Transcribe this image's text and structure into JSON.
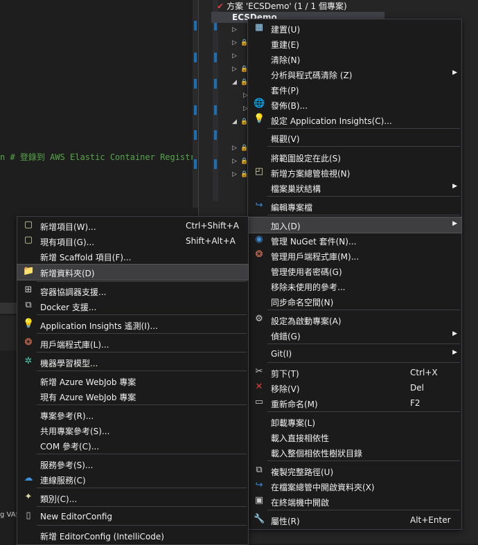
{
  "editor": {
    "code_text": "n # 登錄到 AWS Elastic Container Registry",
    "vas_text": "g VAS"
  },
  "solution_explorer": {
    "solution_label": "方案 'ECSDemo' (1 / 1 個專案)",
    "project_label": "ECSDemo"
  },
  "main_menu": {
    "items": [
      {
        "icon": "build-icon",
        "label": "建置(U)"
      },
      {
        "icon": "",
        "label": "重建(E)"
      },
      {
        "icon": "",
        "label": "清除(N)"
      },
      {
        "icon": "",
        "label": "分析與程式碼清除 (Z)",
        "arrow": "▶"
      },
      {
        "icon": "",
        "label": "套件(P)"
      },
      {
        "icon": "publish-icon",
        "label": "發佈(B)..."
      },
      {
        "icon": "app-insights-icon",
        "label": "設定 Application Insights(C)..."
      },
      {
        "icon": "",
        "label": "概觀(V)"
      },
      {
        "icon": "",
        "label": "將範圍設定在此(S)"
      },
      {
        "icon": "new-view-icon",
        "label": "新增方案總管檢視(N)"
      },
      {
        "icon": "",
        "label": "檔案巢狀結構",
        "arrow": "▶"
      },
      {
        "icon": "edit-project-icon",
        "label": "編輯專案檔"
      },
      {
        "icon": "",
        "label": "加入(D)",
        "arrow": "▶"
      },
      {
        "icon": "nuget-icon",
        "label": "管理 NuGet 套件(N)..."
      },
      {
        "icon": "client-lib-icon",
        "label": "管理用戶端程式庫(M)..."
      },
      {
        "icon": "",
        "label": "管理使用者密碼(G)"
      },
      {
        "icon": "",
        "label": "移除未使用的參考..."
      },
      {
        "icon": "",
        "label": "同步命名空間(N)"
      },
      {
        "icon": "gear-icon",
        "label": "設定為啟動專案(A)"
      },
      {
        "icon": "",
        "label": "偵錯(G)",
        "arrow": "▶"
      },
      {
        "icon": "",
        "label": "Git(I)",
        "arrow": "▶"
      },
      {
        "icon": "scissors-icon",
        "label": "剪下(T)",
        "shortcut": "Ctrl+X"
      },
      {
        "icon": "delete-icon",
        "label": "移除(V)",
        "shortcut": "Del"
      },
      {
        "icon": "rename-icon",
        "label": "重新命名(M)",
        "shortcut": "F2"
      },
      {
        "icon": "",
        "label": "卸載專案(L)"
      },
      {
        "icon": "",
        "label": "載入直接相依性"
      },
      {
        "icon": "",
        "label": "載入整個相依性樹狀目錄"
      },
      {
        "icon": "copy-icon",
        "label": "複製完整路徑(U)"
      },
      {
        "icon": "open-folder-icon",
        "label": "在檔案總管中開啟資料夾(X)"
      },
      {
        "icon": "terminal-icon",
        "label": "在終端機中開啟"
      },
      {
        "icon": "wrench-icon",
        "label": "屬性(R)",
        "shortcut": "Alt+Enter"
      }
    ]
  },
  "sub_menu": {
    "items": [
      {
        "icon": "new-item-icon",
        "label": "新增項目(W)...",
        "shortcut": "Ctrl+Shift+A"
      },
      {
        "icon": "existing-item-icon",
        "label": "現有項目(G)...",
        "shortcut": "Shift+Alt+A"
      },
      {
        "icon": "",
        "label": "新增 Scaffold 項目(F)..."
      },
      {
        "icon": "new-folder-icon",
        "label": "新增資料夾(D)"
      },
      {
        "icon": "container-orchestrator-icon",
        "label": "容器協調器支援..."
      },
      {
        "icon": "docker-icon",
        "label": "Docker 支援..."
      },
      {
        "icon": "app-insights-icon",
        "label": "Application Insights 遙測(I)..."
      },
      {
        "icon": "client-lib-icon",
        "label": "用戶端程式庫(L)..."
      },
      {
        "icon": "ml-model-icon",
        "label": "機器學習模型..."
      },
      {
        "icon": "",
        "label": "新增 Azure WebJob 專案"
      },
      {
        "icon": "",
        "label": "現有 Azure WebJob 專案"
      },
      {
        "icon": "",
        "label": "專案參考(R)..."
      },
      {
        "icon": "",
        "label": "共用專案參考(S)..."
      },
      {
        "icon": "",
        "label": "COM 參考(C)..."
      },
      {
        "icon": "",
        "label": "服務參考(S)..."
      },
      {
        "icon": "connected-service-icon",
        "label": "連線服務(C)"
      },
      {
        "icon": "class-icon",
        "label": "類別(C)..."
      },
      {
        "icon": "file-icon",
        "label": "New EditorConfig"
      },
      {
        "icon": "",
        "label": "新增 EditorConfig (IntelliCode)"
      }
    ]
  }
}
